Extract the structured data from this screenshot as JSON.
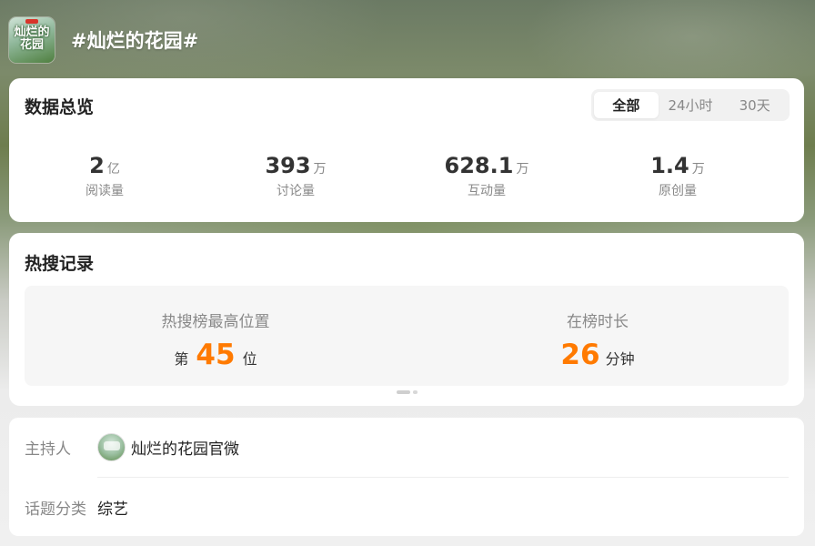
{
  "topic": {
    "title": "#灿烂的花园#",
    "avatar_logo_text": "灿烂的花园"
  },
  "overview": {
    "title": "数据总览",
    "tabs": [
      {
        "label": "全部",
        "active": true
      },
      {
        "label": "24小时",
        "active": false
      },
      {
        "label": "30天",
        "active": false
      }
    ],
    "stats": [
      {
        "value": "2",
        "unit": "亿",
        "label": "阅读量"
      },
      {
        "value": "393",
        "unit": "万",
        "label": "讨论量"
      },
      {
        "value": "628.1",
        "unit": "万",
        "label": "互动量"
      },
      {
        "value": "1.4",
        "unit": "万",
        "label": "原创量"
      }
    ]
  },
  "hot_search": {
    "title": "热搜记录",
    "peak": {
      "label": "热搜榜最高位置",
      "prefix": "第",
      "value": "45",
      "suffix": "位"
    },
    "duration": {
      "label": "在榜时长",
      "value": "26",
      "suffix": "分钟"
    },
    "pager": {
      "total": 2,
      "active": 0
    }
  },
  "info": {
    "host": {
      "key": "主持人",
      "name": "灿烂的花园官微"
    },
    "category": {
      "key": "话题分类",
      "value": "综艺"
    }
  },
  "colors": {
    "accent_orange": "#ff7a00",
    "card_bg": "#ffffff",
    "muted_text": "#888888"
  }
}
